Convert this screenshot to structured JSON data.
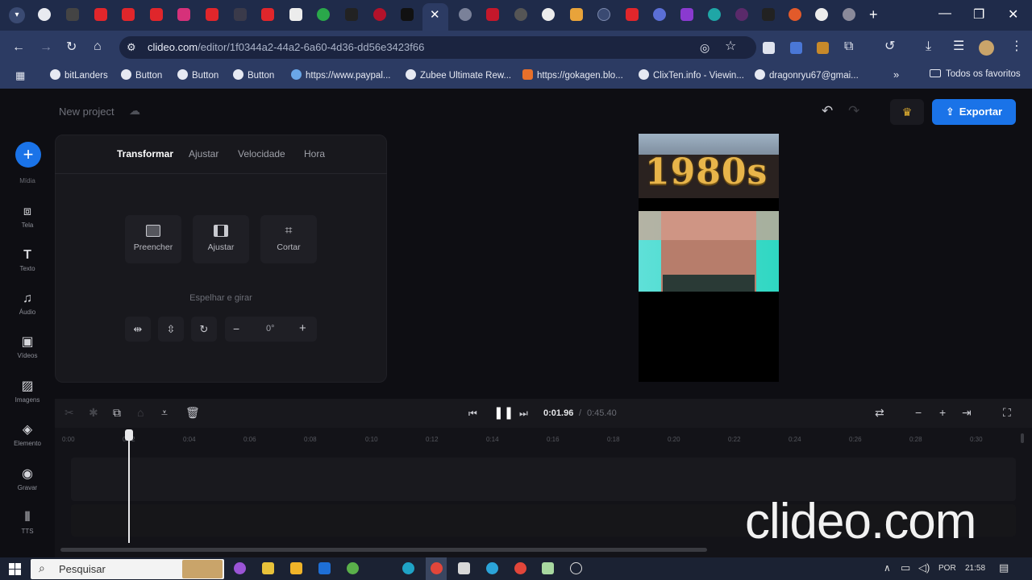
{
  "browser": {
    "url_host": "clideo.com",
    "url_path": "/editor/1f0344a2-44a2-6a60-4d36-dd56e3423f66",
    "bookmarks": [
      "bitLanders",
      "Button",
      "Button",
      "Button",
      "https://www.paypal...",
      "Zubee Ultimate Rew...",
      "https://gokagen.blo...",
      "ClixTen.info - Viewin...",
      "dragonryu67@gmai..."
    ],
    "all_bookmarks": "Todos os favoritos"
  },
  "app": {
    "project_name": "New project",
    "export_label": "Exportar",
    "sidebar": [
      {
        "label": "Mídia",
        "icon": "plus-icon"
      },
      {
        "label": "Tela",
        "icon": "screen-icon"
      },
      {
        "label": "Texto",
        "icon": "text-icon"
      },
      {
        "label": "Áudio",
        "icon": "music-icon"
      },
      {
        "label": "Vídeos",
        "icon": "video-icon"
      },
      {
        "label": "Imagens",
        "icon": "image-icon"
      },
      {
        "label": "Elemento",
        "icon": "shapes-icon"
      },
      {
        "label": "Gravar",
        "icon": "record-icon"
      },
      {
        "label": "TTS",
        "icon": "waveform-icon"
      }
    ],
    "panel": {
      "tabs": [
        "Transformar",
        "Ajustar",
        "Velocidade",
        "Hora"
      ],
      "fit_buttons": [
        "Preencher",
        "Ajustar",
        "Cortar"
      ],
      "mirror_label": "Espelhar e girar",
      "rotation": "0°"
    },
    "preview_text": "1980s",
    "timeline": {
      "current_time": "0:01.96",
      "separator": "/",
      "total_time": "0:45.40",
      "ticks": [
        "0:00",
        "0:02",
        "0:04",
        "0:06",
        "0:08",
        "0:10",
        "0:12",
        "0:14",
        "0:16",
        "0:18",
        "0:20",
        "0:22",
        "0:24",
        "0:26",
        "0:28",
        "0:30"
      ]
    },
    "watermark": "clideo.com"
  },
  "taskbar": {
    "search_placeholder": "Pesquisar",
    "language": "POR",
    "clock": "21:58"
  }
}
